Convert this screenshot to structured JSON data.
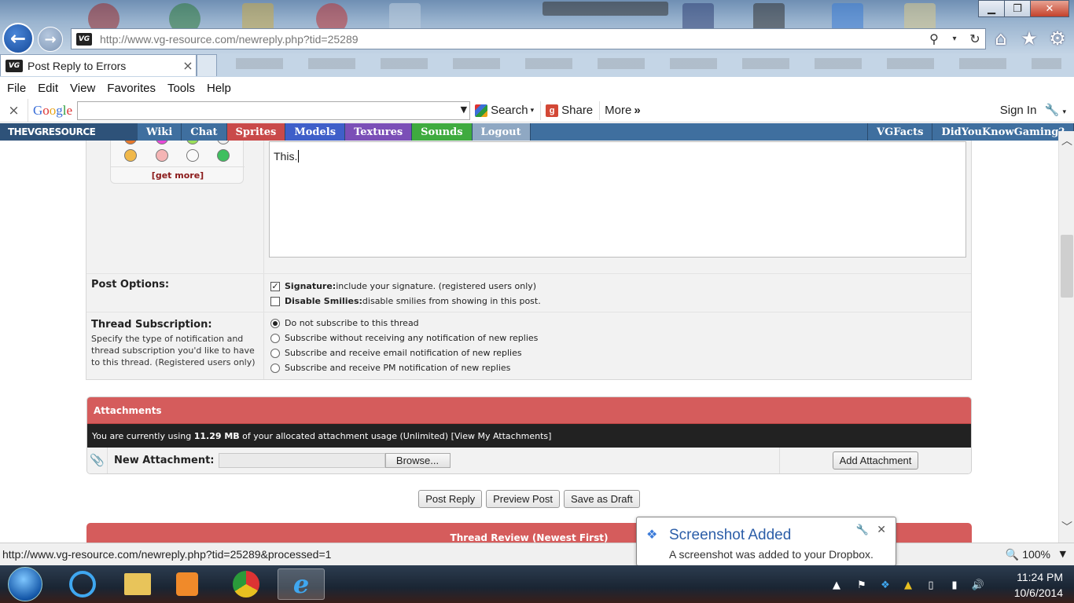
{
  "browser": {
    "url": "http://www.vg-resource.com/newreply.php?tid=25289",
    "tab_title": "Post Reply to Errors",
    "favicon_text": "VG",
    "menu": [
      "File",
      "Edit",
      "View",
      "Favorites",
      "Tools",
      "Help"
    ],
    "google_toolbar": {
      "close_glyph": "×",
      "logo": "Google",
      "search_label": "Search",
      "share_label": "Share",
      "more_label": "More",
      "more_glyph": "»",
      "signin_label": "Sign In"
    },
    "status_url": "http://www.vg-resource.com/newreply.php?tid=25289&processed=1",
    "zoom": "100%",
    "icons": {
      "back": "←",
      "forward": "→",
      "search": "⚲",
      "refresh": "↻",
      "home": "⌂",
      "favorites": "★",
      "settings": "⚙",
      "minimize": "▁",
      "restore": "❐",
      "close": "✕",
      "tab_close": "×"
    }
  },
  "site": {
    "logo": "THEVGRESOURCE",
    "nav": [
      {
        "label": "Wiki",
        "color": "#3f6f9f"
      },
      {
        "label": "Chat",
        "color": "#3f6f9f"
      },
      {
        "label": "Sprites",
        "color": "#c94a4a"
      },
      {
        "label": "Models",
        "color": "#3f5fc9"
      },
      {
        "label": "Textures",
        "color": "#7b4fb7"
      },
      {
        "label": "Sounds",
        "color": "#3fab3f"
      },
      {
        "label": "Logout",
        "color": "#8fa8c3"
      }
    ],
    "nav_right": [
      "VGFacts",
      "DidYouKnowGaming?"
    ]
  },
  "form": {
    "get_more": "[get more]",
    "message": "This.",
    "post_options": {
      "label": "Post Options:",
      "signature": {
        "bold": "Signature:",
        "text": " include your signature. (registered users only)",
        "checked": true
      },
      "disable_smilies": {
        "bold": "Disable Smilies:",
        "text": " disable smilies from showing in this post.",
        "checked": false
      }
    },
    "subscription": {
      "label": "Thread Subscription:",
      "description": "Specify the type of notification and thread subscription you'd like to have to this thread. (Registered users only)",
      "options": [
        {
          "label": "Do not subscribe to this thread",
          "selected": true
        },
        {
          "label": "Subscribe without receiving any notification of new replies",
          "selected": false
        },
        {
          "label": "Subscribe and receive email notification of new replies",
          "selected": false
        },
        {
          "label": "Subscribe and receive PM notification of new replies",
          "selected": false
        }
      ]
    }
  },
  "attachments": {
    "title": "Attachments",
    "usage_prefix": "You are currently using ",
    "usage_amount": "11.29 MB",
    "usage_suffix": " of your allocated attachment usage (Unlimited) [View My Attachments]",
    "new_label": "New Attachment:",
    "browse_label": "Browse...",
    "add_label": "Add Attachment"
  },
  "buttons": {
    "post_reply": "Post Reply",
    "preview": "Preview Post",
    "save_draft": "Save as Draft"
  },
  "thread_review": "Thread Review (Newest First)",
  "toast": {
    "title": "Screenshot Added",
    "message": "A screenshot was added to your Dropbox."
  },
  "taskbar": {
    "time": "11:24 PM",
    "date": "10/6/2014"
  }
}
